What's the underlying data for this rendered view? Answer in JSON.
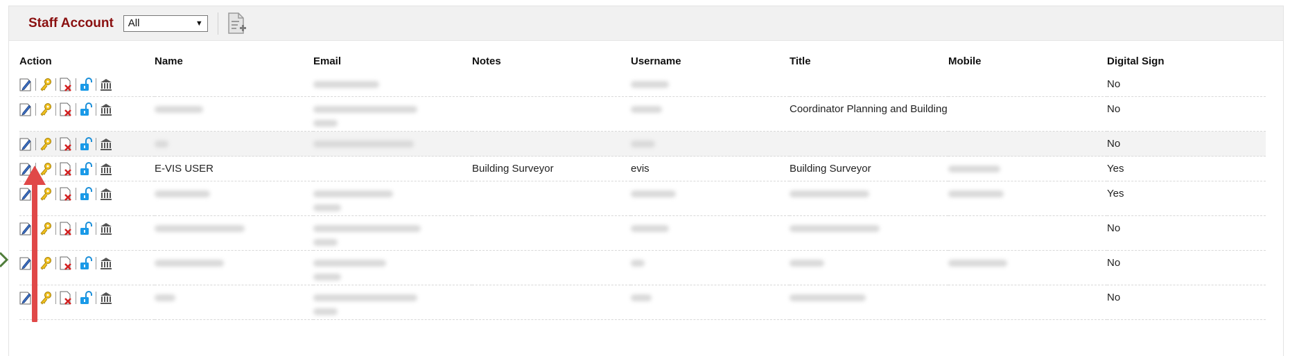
{
  "header": {
    "title": "Staff Account",
    "filter_value": "All"
  },
  "columns": [
    "Action",
    "Name",
    "Email",
    "Notes",
    "Username",
    "Title",
    "Mobile",
    "Digital Sign"
  ],
  "rows": [
    {
      "name": "",
      "email": "",
      "notes": "",
      "username": "",
      "title": "",
      "mobile": "",
      "digital_sign": "No"
    },
    {
      "name": "",
      "email": "",
      "notes": "",
      "username": "",
      "title": "Coordinator Planning and Building",
      "mobile": "",
      "digital_sign": "No"
    },
    {
      "name": "",
      "email": "",
      "notes": "",
      "username": "",
      "title": "",
      "mobile": "",
      "digital_sign": "No"
    },
    {
      "name": "E-VIS USER",
      "email": "",
      "notes": "Building Surveyor",
      "username": "evis",
      "title": "Building Surveyor",
      "mobile": "",
      "digital_sign": "Yes"
    },
    {
      "name": "",
      "email": "",
      "notes": "",
      "username": "",
      "title": "",
      "mobile": "",
      "digital_sign": "Yes"
    },
    {
      "name": "",
      "email": "",
      "notes": "",
      "username": "",
      "title": "",
      "mobile": "",
      "digital_sign": "No"
    },
    {
      "name": "",
      "email": "",
      "notes": "",
      "username": "",
      "title": "",
      "mobile": "",
      "digital_sign": "No"
    },
    {
      "name": "",
      "email": "",
      "notes": "",
      "username": "",
      "title": "",
      "mobile": "",
      "digital_sign": "No"
    }
  ],
  "action_icons": [
    "edit-icon",
    "key-icon",
    "delete-icon",
    "unlock-icon",
    "bank-icon"
  ],
  "colors": {
    "title": "#8a1010",
    "arrow": "#e04848",
    "shade": "#f3f3f3"
  }
}
